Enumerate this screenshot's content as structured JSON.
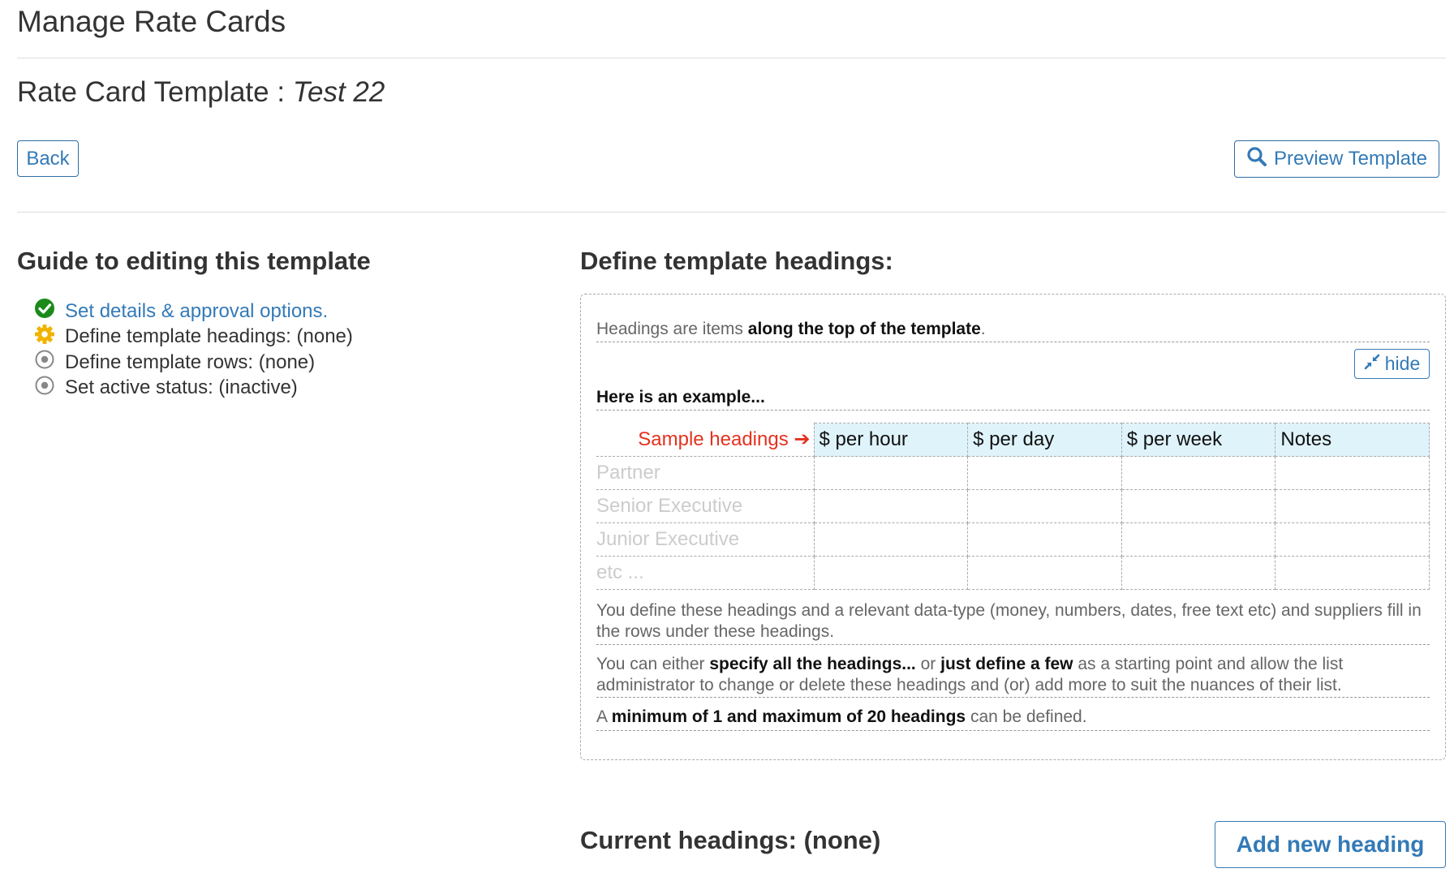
{
  "header": {
    "title": "Manage Rate Cards",
    "subtitle_prefix": "Rate Card Template : ",
    "template_name": "Test 22"
  },
  "toolbar": {
    "back_label": "Back",
    "preview_label": "Preview Template",
    "preview_icon": "search-icon"
  },
  "guide": {
    "title": "Guide to editing this template",
    "steps": [
      {
        "label": "Set details & approval options.",
        "icon": "check-circle-icon",
        "status": "complete",
        "color": "#1a8a1a"
      },
      {
        "label": "Define template headings: (none)",
        "icon": "gear-icon",
        "status": "current",
        "color": "#f0b400"
      },
      {
        "label": "Define template rows: (none)",
        "icon": "radio-dot-icon",
        "status": "pending",
        "color": "#888888"
      },
      {
        "label": "Set active status: (inactive)",
        "icon": "radio-dot-icon",
        "status": "pending",
        "color": "#888888"
      }
    ]
  },
  "definition": {
    "title": "Define template headings:",
    "intro_prefix": "Headings are items ",
    "intro_bold": "along the top of the template",
    "intro_suffix": ".",
    "hide_label": "hide",
    "hide_icon": "compress-icon",
    "example_label": "Here is an example...",
    "sample_label": "Sample headings",
    "sample_headings": [
      "$ per hour",
      "$ per day",
      "$ per week",
      "Notes"
    ],
    "sample_rows": [
      "Partner",
      "Senior Executive",
      "Junior Executive",
      "etc ..."
    ],
    "para1": "You define these headings and a relevant data-type (money, numbers, dates, free text etc) and suppliers fill in the rows under these headings.",
    "para2_a": "You can either ",
    "para2_b": "specify all the headings...",
    "para2_c": " or ",
    "para2_d": "just define a few",
    "para2_e": " as a starting point and allow the list administrator to change or delete these headings and (or) add more to suit the nuances of their list.",
    "para3_a": "A ",
    "para3_b": "minimum of 1 and maximum of 20 headings",
    "para3_c": " can be defined."
  },
  "current": {
    "title": "Current headings: (none)",
    "add_label": "Add new heading"
  },
  "colors": {
    "link": "#337ab7",
    "sample_red": "#e4321f",
    "heading_bg": "#dff3fb"
  }
}
